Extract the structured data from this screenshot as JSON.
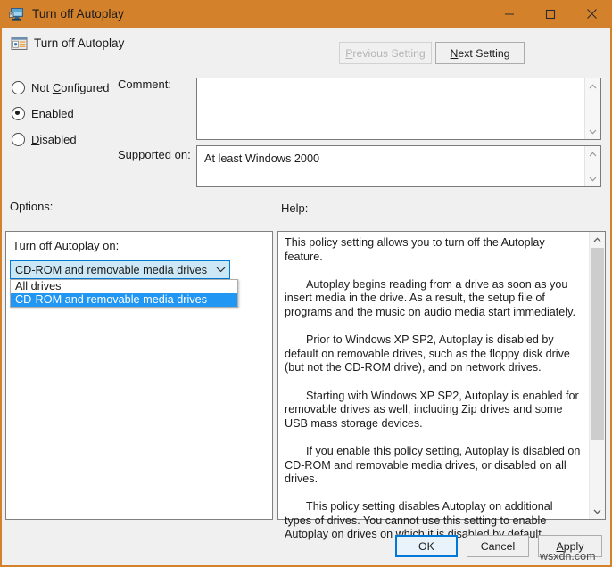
{
  "window": {
    "title": "Turn off Autoplay",
    "title_icon": "computer-monitor-icon",
    "accent_color": "#d4812b",
    "controls": {
      "minimize": "minimize-icon",
      "maximize": "maximize-icon",
      "close": "close-icon"
    }
  },
  "header": {
    "icon": "policy-setting-icon",
    "title": "Turn off Autoplay",
    "previous_setting": "Previous Setting",
    "previous_setting_enabled": false,
    "next_setting": "Next Setting",
    "next_setting_enabled": true
  },
  "state": {
    "options": [
      {
        "label": "Not Configured",
        "accel": "C",
        "selected": false
      },
      {
        "label": "Enabled",
        "accel": "E",
        "selected": true
      },
      {
        "label": "Disabled",
        "accel": "D",
        "selected": false
      }
    ]
  },
  "fields": {
    "comment_label": "Comment:",
    "comment_value": "",
    "supported_on_label": "Supported on:",
    "supported_on_value": "At least Windows 2000"
  },
  "sections": {
    "options_label": "Options:",
    "help_label": "Help:"
  },
  "options_panel": {
    "dropdown_label": "Turn off Autoplay on:",
    "dropdown_value": "CD-ROM and removable media drives",
    "dropdown_open": true,
    "dropdown_items": [
      {
        "label": "All drives",
        "selected": false
      },
      {
        "label": "CD-ROM and removable media drives",
        "selected": true
      }
    ],
    "highlight_color": "#2196f3"
  },
  "help": {
    "paragraphs": [
      "This policy setting allows you to turn off the Autoplay feature.",
      "Autoplay begins reading from a drive as soon as you insert media in the drive. As a result, the setup file of programs and the music on audio media start immediately.",
      "Prior to Windows XP SP2, Autoplay is disabled by default on removable drives, such as the floppy disk drive (but not the CD-ROM drive), and on network drives.",
      "Starting with Windows XP SP2, Autoplay is enabled for removable drives as well, including Zip drives and some USB mass storage devices.",
      "If you enable this policy setting, Autoplay is disabled on CD-ROM and removable media drives, or disabled on all drives.",
      "This policy setting disables Autoplay on additional types of drives. You cannot use this setting to enable Autoplay on drives on which it is disabled by default."
    ]
  },
  "buttons": {
    "ok": "OK",
    "cancel": "Cancel",
    "apply": "Apply",
    "apply_accel": "A"
  },
  "watermark": "wsxdn.com"
}
